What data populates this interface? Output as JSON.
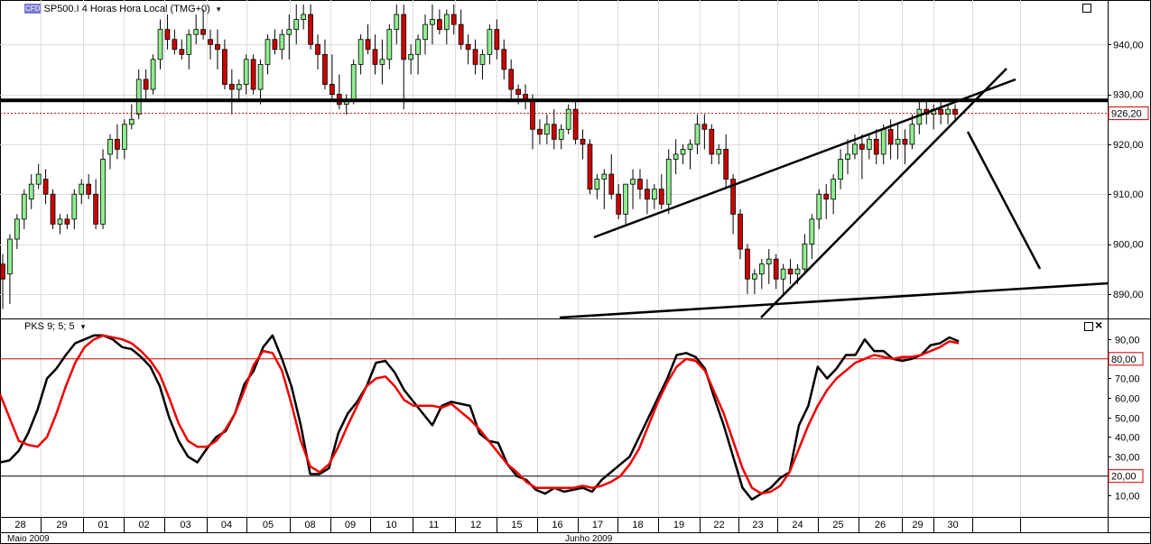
{
  "main_panel": {
    "symbol_badge": "CFD",
    "title": "SP500.I 4 Horas Hora Local (TMG+0)",
    "dropdown_glyph": "▾",
    "price_ticks": [
      "940,00",
      "930,00",
      "920,00",
      "910,00",
      "900,00",
      "890,00"
    ],
    "current_price_label": "926,20"
  },
  "indicator_panel": {
    "title": "PKS 9; 5; 5",
    "dropdown_glyph": "▾",
    "close_glyph": "×",
    "ticks": [
      "90,00",
      "70,00",
      "60,00",
      "50,00",
      "40,00",
      "30,00",
      "10,00"
    ],
    "upper_level_label": "80,00",
    "lower_level_label": "20,00"
  },
  "x_axis": {
    "days": [
      "28",
      "29",
      "01",
      "02",
      "03",
      "04",
      "05",
      "08",
      "09",
      "10",
      "11",
      "12",
      "15",
      "16",
      "17",
      "18",
      "19",
      "22",
      "23",
      "24",
      "25",
      "26",
      "29",
      "30"
    ],
    "months": [
      "Maio 2009",
      "Junho 2009"
    ]
  },
  "colors": {
    "bull_candle": "#90ee90",
    "bear_candle": "#cc0000",
    "resistance_line": "#000000",
    "price_marker": "#cc0000",
    "k_line": "#000000",
    "d_line": "#ee0000",
    "stoch_level": "#cc0000"
  },
  "chart_data": [
    {
      "type": "candlestick",
      "title": "SP500.I 4 Horas Hora Local (TMG+0)",
      "ylim": [
        886,
        948
      ],
      "y_ticks": [
        890,
        900,
        910,
        920,
        930,
        940
      ],
      "current_price": 926.2,
      "resistance_level": 928.8,
      "ohlc": [
        [
          896,
          898,
          887,
          893
        ],
        [
          894,
          902,
          888,
          901
        ],
        [
          901,
          906,
          899,
          905
        ],
        [
          905,
          911,
          903,
          910
        ],
        [
          909,
          914,
          907,
          912
        ],
        [
          912,
          916,
          911,
          914
        ],
        [
          913,
          915,
          908,
          910
        ],
        [
          910,
          911,
          903,
          904
        ],
        [
          904,
          906,
          902,
          905
        ],
        [
          905,
          906,
          903,
          904
        ],
        [
          905,
          911,
          903,
          910
        ],
        [
          910,
          913,
          908,
          912
        ],
        [
          912,
          914,
          909,
          910
        ],
        [
          910,
          913,
          903,
          904
        ],
        [
          904,
          919,
          903,
          917
        ],
        [
          918,
          922,
          915,
          921
        ],
        [
          921,
          924,
          917,
          919
        ],
        [
          919,
          925,
          917,
          924
        ],
        [
          924,
          928,
          923,
          925
        ],
        [
          926,
          935,
          925,
          933
        ],
        [
          933,
          935,
          929,
          931
        ],
        [
          931,
          938,
          930,
          937
        ],
        [
          937,
          945,
          935,
          943
        ],
        [
          943,
          946,
          939,
          941
        ],
        [
          941,
          943,
          938,
          939
        ],
        [
          939,
          941,
          937,
          938
        ],
        [
          938,
          943,
          935,
          942
        ],
        [
          942,
          946,
          940,
          943
        ],
        [
          943,
          947,
          941,
          942
        ],
        [
          941,
          943,
          937,
          940
        ],
        [
          940,
          943,
          935,
          939
        ],
        [
          939,
          941,
          931,
          932
        ],
        [
          932,
          935,
          926,
          931
        ],
        [
          931,
          933,
          929,
          932
        ],
        [
          932,
          938,
          930,
          937
        ],
        [
          937,
          938,
          930,
          931
        ],
        [
          931,
          937,
          928,
          936
        ],
        [
          936,
          942,
          934,
          941
        ],
        [
          941,
          943,
          938,
          939
        ],
        [
          939,
          943,
          937,
          942
        ],
        [
          942,
          946,
          937,
          943
        ],
        [
          943,
          948,
          940,
          945
        ],
        [
          945,
          948,
          943,
          946
        ],
        [
          946,
          948,
          939,
          940
        ],
        [
          940,
          942,
          935,
          938
        ],
        [
          938,
          941,
          931,
          932
        ],
        [
          932,
          938,
          929,
          930
        ],
        [
          930,
          934,
          927,
          928
        ],
        [
          928,
          930,
          926,
          929
        ],
        [
          929,
          937,
          928,
          936
        ],
        [
          936,
          942,
          934,
          941
        ],
        [
          941,
          944,
          938,
          939
        ],
        [
          939,
          942,
          934,
          936
        ],
        [
          936,
          941,
          932,
          937
        ],
        [
          937,
          944,
          935,
          943
        ],
        [
          943,
          948,
          940,
          946
        ],
        [
          946,
          948,
          927,
          937
        ],
        [
          937,
          940,
          934,
          938
        ],
        [
          938,
          942,
          934,
          941
        ],
        [
          941,
          946,
          938,
          944
        ],
        [
          944,
          948,
          940,
          945
        ],
        [
          945,
          947,
          942,
          943
        ],
        [
          943,
          947,
          940,
          946
        ],
        [
          946,
          948,
          942,
          944
        ],
        [
          944,
          947,
          939,
          940
        ],
        [
          940,
          942,
          936,
          939
        ],
        [
          939,
          941,
          934,
          936
        ],
        [
          936,
          939,
          933,
          938
        ],
        [
          938,
          944,
          936,
          943
        ],
        [
          943,
          945,
          937,
          939
        ],
        [
          939,
          941,
          933,
          935
        ],
        [
          935,
          937,
          929,
          931
        ],
        [
          931,
          932,
          928,
          930
        ],
        [
          930,
          932,
          927,
          929
        ],
        [
          929,
          930,
          919,
          923
        ],
        [
          923,
          925,
          920,
          922
        ],
        [
          922,
          926,
          920,
          924
        ],
        [
          924,
          927,
          919,
          921
        ],
        [
          921,
          924,
          919,
          923
        ],
        [
          923,
          928,
          922,
          927
        ],
        [
          927,
          929,
          920,
          921
        ],
        [
          921,
          923,
          917,
          920
        ],
        [
          920,
          921,
          910,
          911
        ],
        [
          911,
          914,
          909,
          913
        ],
        [
          913,
          915,
          907,
          914
        ],
        [
          914,
          918,
          909,
          910
        ],
        [
          910,
          912,
          905,
          906
        ],
        [
          906,
          912,
          904,
          912
        ],
        [
          912,
          915,
          907,
          913
        ],
        [
          913,
          915,
          909,
          911
        ],
        [
          911,
          913,
          906,
          909
        ],
        [
          909,
          912,
          907,
          911
        ],
        [
          911,
          914,
          907,
          908
        ],
        [
          908,
          919,
          906,
          917
        ],
        [
          917,
          921,
          914,
          918
        ],
        [
          918,
          920,
          916,
          919
        ],
        [
          919,
          921,
          915,
          920
        ],
        [
          920,
          926,
          918,
          924
        ],
        [
          924,
          926,
          919,
          923
        ],
        [
          923,
          924,
          916,
          918
        ],
        [
          918,
          920,
          916,
          919
        ],
        [
          919,
          922,
          911,
          913
        ],
        [
          913,
          914,
          902,
          906
        ],
        [
          906,
          907,
          897,
          899
        ],
        [
          899,
          900,
          890,
          893
        ],
        [
          893,
          895,
          890,
          894
        ],
        [
          894,
          897,
          891,
          896
        ],
        [
          896,
          899,
          892,
          897
        ],
        [
          897,
          898,
          891,
          893
        ],
        [
          893,
          896,
          890,
          895
        ],
        [
          895,
          897,
          892,
          894
        ],
        [
          894,
          896,
          892,
          895
        ],
        [
          895,
          902,
          894,
          900
        ],
        [
          900,
          906,
          897,
          905
        ],
        [
          905,
          911,
          903,
          910
        ],
        [
          910,
          912,
          905,
          909
        ],
        [
          909,
          914,
          906,
          913
        ],
        [
          913,
          919,
          911,
          917
        ],
        [
          917,
          921,
          914,
          918
        ],
        [
          918,
          922,
          917,
          920
        ],
        [
          920,
          922,
          913,
          919
        ],
        [
          919,
          922,
          917,
          921
        ],
        [
          921,
          923,
          916,
          918
        ],
        [
          918,
          924,
          916,
          923
        ],
        [
          923,
          925,
          917,
          920
        ],
        [
          920,
          924,
          917,
          921
        ],
        [
          921,
          923,
          916,
          920
        ],
        [
          920,
          926,
          919,
          924
        ],
        [
          924,
          929,
          922,
          927
        ],
        [
          927,
          929,
          924,
          926
        ],
        [
          926,
          928,
          923,
          927
        ],
        [
          927,
          929,
          924,
          926
        ],
        [
          926,
          928,
          924,
          927
        ],
        [
          927,
          928,
          925,
          926
        ]
      ],
      "trendlines": [
        {
          "from": [
            658,
            263
          ],
          "to": [
            1125,
            88
          ]
        },
        {
          "from": [
            843,
            352
          ],
          "to": [
            1115,
            76
          ]
        },
        {
          "from": [
            1072,
            146
          ],
          "to": [
            1152,
            298
          ]
        },
        {
          "from": [
            620,
            352
          ],
          "to": [
            1228,
            314
          ]
        }
      ]
    },
    {
      "type": "line",
      "title": "PKS 9; 5; 5",
      "ylim": [
        0,
        97
      ],
      "y_ticks": [
        10,
        20,
        30,
        40,
        50,
        60,
        70,
        80,
        90
      ],
      "levels": [
        80,
        20
      ],
      "series": [
        {
          "name": "K",
          "values": [
            27,
            28,
            33,
            42,
            54,
            70,
            75,
            82,
            88,
            90,
            92,
            92,
            90,
            86,
            85,
            81,
            76,
            66,
            50,
            38,
            30,
            27,
            34,
            40,
            43,
            52,
            67,
            74,
            86,
            92,
            80,
            66,
            46,
            21,
            21,
            24,
            42,
            52,
            58,
            66,
            78,
            79,
            73,
            64,
            58,
            52,
            46,
            56,
            58,
            57,
            56,
            42,
            38,
            37,
            26,
            20,
            18,
            13,
            11,
            14,
            12,
            13,
            14,
            12,
            18,
            22,
            26,
            30,
            40,
            50,
            60,
            70,
            82,
            83,
            81,
            75,
            60,
            46,
            30,
            14,
            8,
            11,
            14,
            19,
            22,
            46,
            56,
            76,
            70,
            75,
            82,
            82,
            90,
            84,
            84,
            80,
            79,
            80,
            82,
            87,
            88,
            91,
            89
          ]
        },
        {
          "name": "D",
          "values": [
            62,
            50,
            38,
            36,
            35,
            40,
            52,
            66,
            78,
            86,
            90,
            92,
            91,
            90,
            88,
            84,
            79,
            72,
            60,
            47,
            38,
            35,
            35,
            38,
            44,
            52,
            64,
            77,
            84,
            83,
            74,
            57,
            38,
            25,
            22,
            26,
            35,
            46,
            56,
            66,
            70,
            71,
            66,
            59,
            56,
            56,
            56,
            55,
            57,
            53,
            49,
            44,
            38,
            32,
            26,
            22,
            17,
            14,
            14,
            14,
            14,
            14,
            15,
            14,
            15,
            17,
            20,
            26,
            34,
            46,
            58,
            68,
            76,
            80,
            79,
            74,
            63,
            52,
            38,
            24,
            14,
            11,
            12,
            15,
            22,
            34,
            46,
            56,
            64,
            70,
            74,
            78,
            80,
            82,
            81,
            80,
            81,
            81,
            82,
            84,
            86,
            89,
            88
          ]
        }
      ]
    }
  ]
}
